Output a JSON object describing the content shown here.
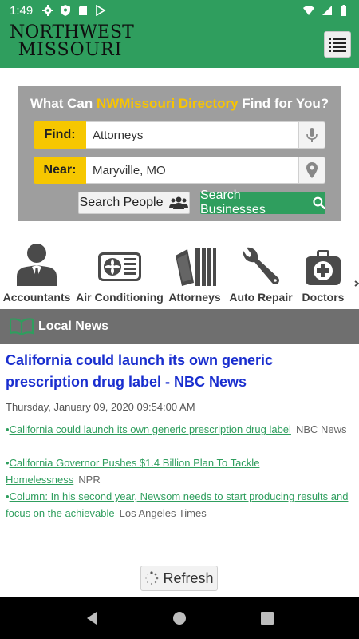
{
  "status_bar": {
    "time": "1:49"
  },
  "header": {
    "logo_line1": "NORTHWEST",
    "logo_line2": "MISSOURI"
  },
  "search": {
    "title_prefix": "What Can ",
    "title_brand": "NWMissouri Directory",
    "title_suffix": " Find for You?",
    "find_label": "Find:",
    "find_value": "Attorneys",
    "near_label": "Near:",
    "near_value": "Maryville, MO",
    "people_button": "Search People",
    "business_button": "Search Businesses"
  },
  "categories": [
    {
      "label": "Accountants",
      "icon": "accountant-icon"
    },
    {
      "label": "Air Conditioning",
      "icon": "air-conditioner-icon"
    },
    {
      "label": "Attorneys",
      "icon": "law-books-icon"
    },
    {
      "label": "Auto Repair",
      "icon": "wrench-icon"
    },
    {
      "label": "Doctors",
      "icon": "first-aid-kit-icon"
    }
  ],
  "news": {
    "section_title": "Local News",
    "headline": "California could launch its own generic prescription drug label - NBC News",
    "date": "Thursday, January 09, 2020 09:54:00 AM",
    "articles": [
      {
        "title": "California could launch its own generic prescription drug label",
        "source": "NBC News"
      },
      {
        "title": "California Governor Pushes $1.4 Billion Plan To Tackle Homelessness",
        "source": "NPR"
      },
      {
        "title": "Column: In his second year, Newsom needs to start producing results and focus on the achievable",
        "source": "Los Angeles Times"
      }
    ],
    "refresh_label": "Refresh"
  },
  "colors": {
    "brand_green": "#2f9e5e",
    "brand_yellow": "#f6c700",
    "headline_blue": "#1a2fcf",
    "panel_gray": "#9e9e9e",
    "news_bar_gray": "#6f6f6f"
  }
}
